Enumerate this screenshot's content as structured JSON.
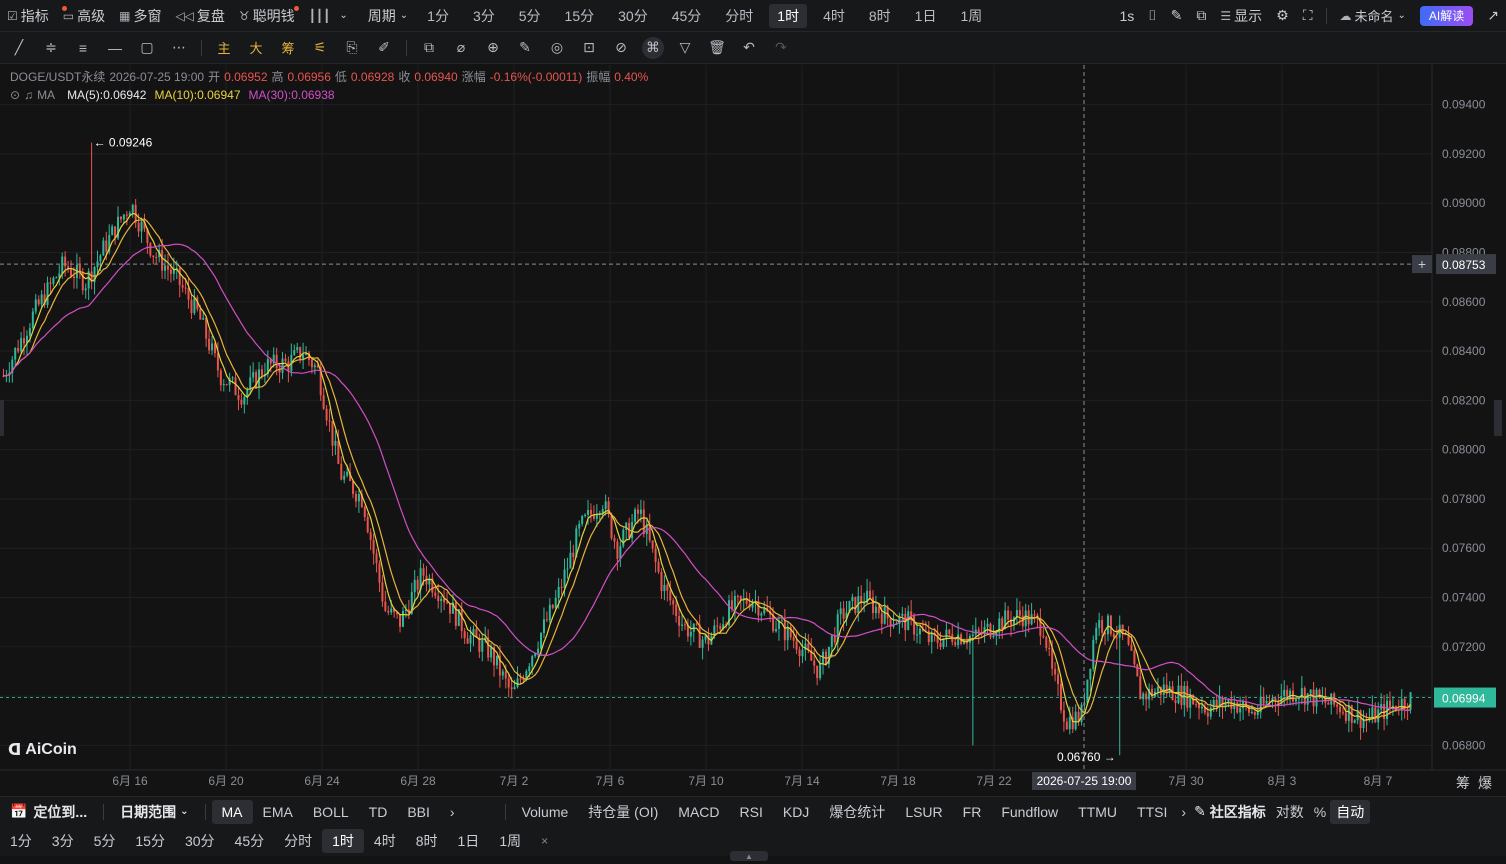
{
  "toolbar": {
    "indicators": "指标",
    "advanced": "高级",
    "multi_window": "多窗",
    "replay": "复盘",
    "smart_money": "聪明钱",
    "period_label": "周期",
    "periods": [
      "1分",
      "3分",
      "5分",
      "15分",
      "30分",
      "45分",
      "分时",
      "1时",
      "4时",
      "8时",
      "1日",
      "1周"
    ],
    "active_period": "1时",
    "realtime": "1s",
    "display": "显示",
    "layout_name": "未命名",
    "ai_read": "AI解读"
  },
  "draw_tools": {
    "main": "主",
    "big": "大",
    "chips": "筹"
  },
  "info": {
    "symbol": "DOGE/USDT永续",
    "datetime": "2026-07-25 19:00",
    "open_label": "开",
    "open": "0.06952",
    "high_label": "高",
    "high": "0.06956",
    "low_label": "低",
    "low": "0.06928",
    "close_label": "收",
    "close": "0.06940",
    "change_label": "涨幅",
    "change": "-0.16%(-0.00011)",
    "amp_label": "振幅",
    "amp": "0.40%",
    "ma_name": "MA",
    "ma5": "MA(5):0.06942",
    "ma10": "MA(10):0.06947",
    "ma30": "MA(30):0.06938"
  },
  "chart_data": {
    "type": "candlestick",
    "y_ticks": [
      "0.09400",
      "0.09200",
      "0.09000",
      "0.08800",
      "0.08600",
      "0.08400",
      "0.08200",
      "0.08000",
      "0.07800",
      "0.07600",
      "0.07400",
      "0.07200",
      "0.07000",
      "0.06800"
    ],
    "y_values": [
      0.094,
      0.092,
      0.09,
      0.088,
      0.086,
      0.084,
      0.082,
      0.08,
      0.078,
      0.076,
      0.074,
      0.072,
      0.07,
      0.068
    ],
    "x_ticks": [
      "6月 16",
      "6月 20",
      "6月 24",
      "6月 28",
      "7月 2",
      "7月 6",
      "7月 10",
      "7月 14",
      "7月 18",
      "7月 22",
      "7月 30",
      "8月 3",
      "8月 7"
    ],
    "crosshair_time": "2026-07-25 19:00",
    "crosshair_price": "0.08753",
    "last_price": "0.06994",
    "high_marker": "0.09246",
    "low_marker": "0.06760",
    "series_colors": {
      "ma5": "#e8d33a",
      "ma10": "#e8b33a",
      "ma30": "#d14fc6",
      "up": "#2fb89a",
      "down": "#e8554e"
    },
    "price_path": [
      [
        0,
        0.083
      ],
      [
        0.02,
        0.0855
      ],
      [
        0.04,
        0.0875
      ],
      [
        0.055,
        0.0868
      ],
      [
        0.07,
        0.0885
      ],
      [
        0.085,
        0.09
      ],
      [
        0.1,
        0.088
      ],
      [
        0.115,
        0.087
      ],
      [
        0.13,
        0.0855
      ],
      [
        0.145,
        0.083
      ],
      [
        0.16,
        0.0822
      ],
      [
        0.175,
        0.0834
      ],
      [
        0.19,
        0.0835
      ],
      [
        0.2,
        0.084
      ],
      [
        0.21,
        0.0832
      ],
      [
        0.225,
        0.079
      ],
      [
        0.24,
        0.078
      ],
      [
        0.255,
        0.0735
      ],
      [
        0.265,
        0.073
      ],
      [
        0.28,
        0.075
      ],
      [
        0.295,
        0.074
      ],
      [
        0.31,
        0.0725
      ],
      [
        0.325,
        0.0718
      ],
      [
        0.34,
        0.07
      ],
      [
        0.355,
        0.072
      ],
      [
        0.37,
        0.074
      ],
      [
        0.385,
        0.0768
      ],
      [
        0.4,
        0.078
      ],
      [
        0.41,
        0.076
      ],
      [
        0.425,
        0.0775
      ],
      [
        0.44,
        0.0745
      ],
      [
        0.455,
        0.0728
      ],
      [
        0.47,
        0.0722
      ],
      [
        0.485,
        0.0735
      ],
      [
        0.5,
        0.074
      ],
      [
        0.515,
        0.073
      ],
      [
        0.53,
        0.0722
      ],
      [
        0.545,
        0.071
      ],
      [
        0.56,
        0.0733
      ],
      [
        0.575,
        0.074
      ],
      [
        0.59,
        0.0732
      ],
      [
        0.605,
        0.073
      ],
      [
        0.62,
        0.0722
      ],
      [
        0.635,
        0.0725
      ],
      [
        0.65,
        0.0724
      ],
      [
        0.665,
        0.073
      ],
      [
        0.68,
        0.0733
      ],
      [
        0.695,
        0.0728
      ],
      [
        0.7,
        0.071
      ],
      [
        0.71,
        0.069
      ],
      [
        0.72,
        0.0692
      ],
      [
        0.73,
        0.073
      ],
      [
        0.74,
        0.0728
      ],
      [
        0.75,
        0.0722
      ],
      [
        0.76,
        0.07
      ],
      [
        0.775,
        0.0703
      ],
      [
        0.79,
        0.07
      ],
      [
        0.805,
        0.0695
      ],
      [
        0.82,
        0.0698
      ],
      [
        0.835,
        0.0693
      ],
      [
        0.85,
        0.07
      ],
      [
        0.865,
        0.0702
      ],
      [
        0.88,
        0.0698
      ],
      [
        0.895,
        0.0695
      ],
      [
        0.91,
        0.069
      ],
      [
        0.925,
        0.0695
      ],
      [
        0.94,
        0.0699
      ]
    ]
  },
  "bottom_left": {
    "locate": "定位到...",
    "date_range": "日期范围"
  },
  "main_indicators": [
    "MA",
    "EMA",
    "BOLL",
    "TD",
    "BBI"
  ],
  "sub_indicators": [
    "Volume",
    "持仓量 (OI)",
    "MACD",
    "RSI",
    "KDJ",
    "爆仓统计",
    "LSUR",
    "FR",
    "Fundflow",
    "TTMU",
    "TTSI"
  ],
  "right_indicators": {
    "community": "社区指标",
    "log": "对数",
    "pct": "%",
    "auto": "自动"
  },
  "right_labels": {
    "chips": "筹",
    "liq": "爆"
  },
  "bottom_periods": [
    "1分",
    "3分",
    "5分",
    "15分",
    "30分",
    "45分",
    "分时",
    "1时",
    "4时",
    "8时",
    "1日",
    "1周"
  ],
  "active_bottom_period": "1时",
  "logo": "AiCoin"
}
